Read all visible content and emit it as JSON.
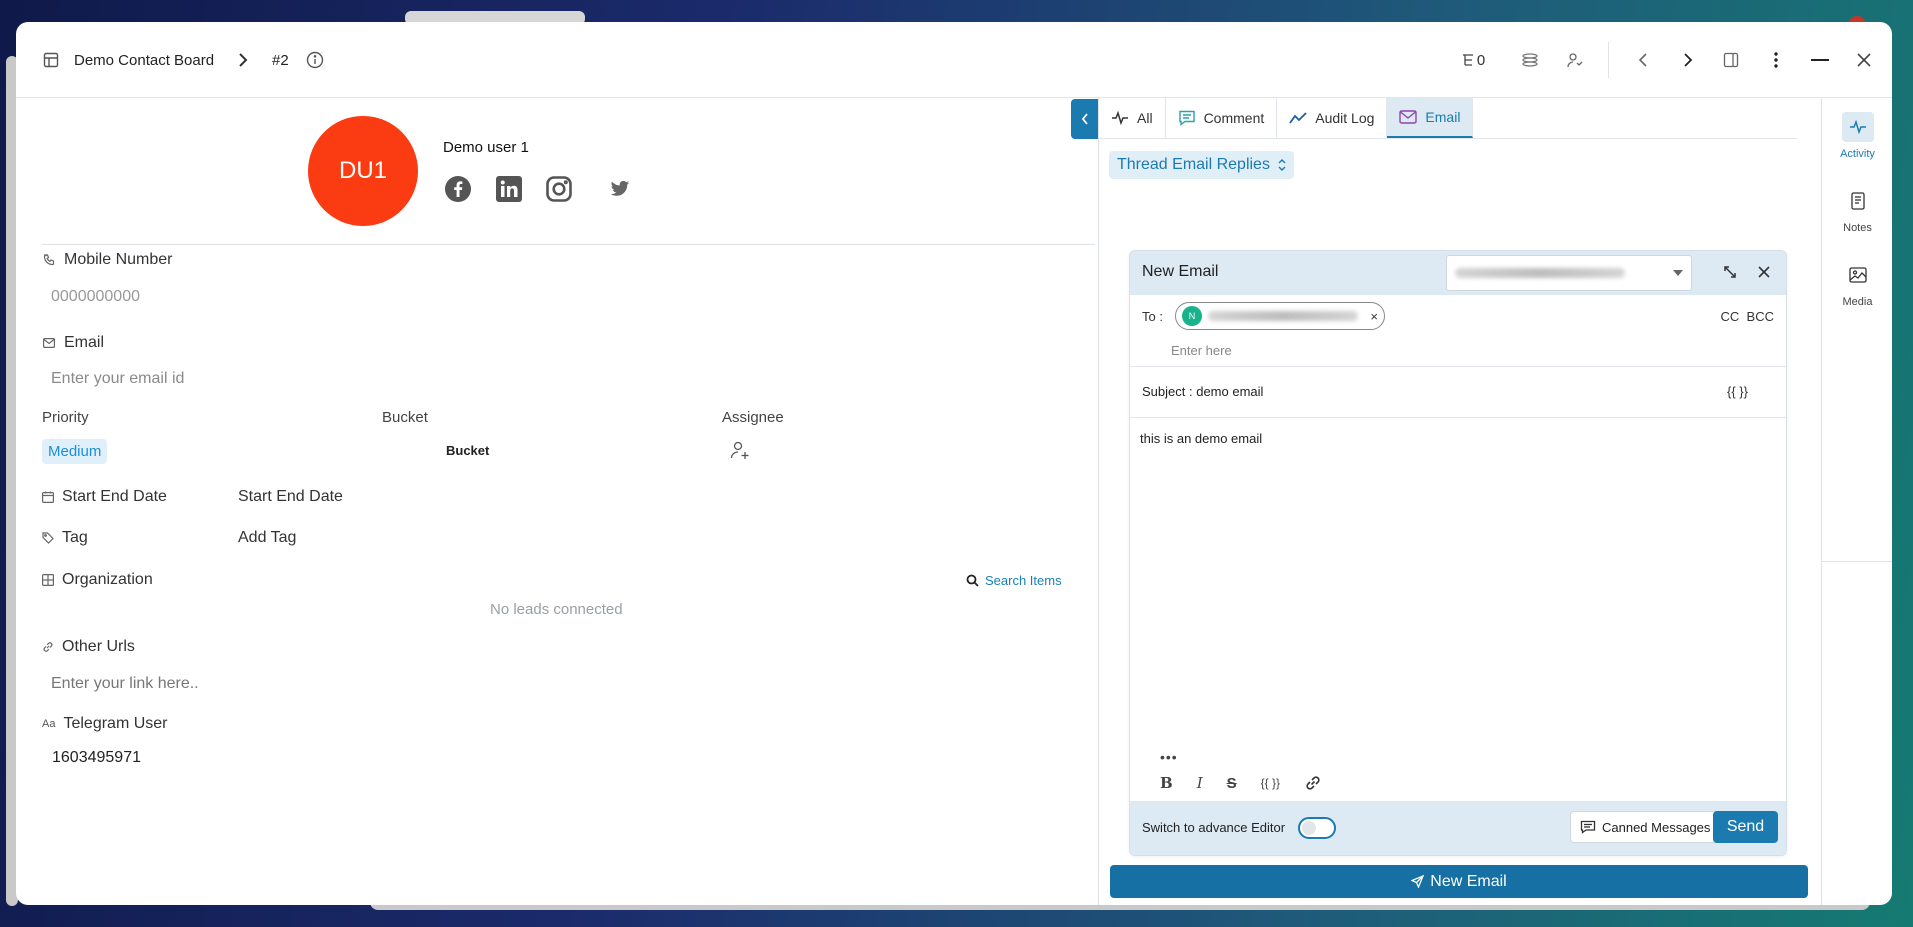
{
  "header": {
    "board_title": "Demo Contact Board",
    "record_id": "#2",
    "count": "0"
  },
  "profile": {
    "initials": "DU1",
    "name": "Demo user 1",
    "avatar_color": "#fb3b12"
  },
  "fields": {
    "mobile_label": "Mobile Number",
    "mobile_placeholder": "0000000000",
    "email_label": "Email",
    "email_placeholder": "Enter your email id",
    "priority_label": "Priority",
    "priority_value": "Medium",
    "bucket_label": "Bucket",
    "bucket_value": "Bucket",
    "assignee_label": "Assignee",
    "start_end_label": "Start End Date",
    "start_end_value": "Start End Date",
    "tag_label": "Tag",
    "tag_value": "Add Tag",
    "organization_label": "Organization",
    "search_items": "Search Items",
    "no_leads": "No leads connected",
    "other_urls_label": "Other Urls",
    "other_urls_placeholder": "Enter your link here..",
    "telegram_label": "Telegram User",
    "telegram_value": "1603495971"
  },
  "tabs": [
    {
      "label": "All",
      "icon": "activity-icon"
    },
    {
      "label": "Comment",
      "icon": "comment-icon"
    },
    {
      "label": "Audit Log",
      "icon": "audit-log-icon"
    },
    {
      "label": "Email",
      "icon": "mail-icon",
      "active": true
    }
  ],
  "thread_replies": "Thread Email Replies",
  "email": {
    "title": "New Email",
    "to_label": "To :",
    "to_chip_initial": "N",
    "cc": "CC",
    "bcc": "BCC",
    "to_placeholder": "Enter here",
    "subject_label": "Subject :",
    "subject_value": "demo email",
    "subject_variable": "{{ }}",
    "body": "this is an demo email",
    "ellipsis": "•••",
    "variable_btn": "{{ }}",
    "advance_editor_label": "Switch to advance Editor",
    "canned_label": "Canned Messages",
    "send_label": "Send"
  },
  "new_email_button": "New Email",
  "rail": [
    {
      "label": "Activity",
      "active": true
    },
    {
      "label": "Notes"
    },
    {
      "label": "Media"
    }
  ],
  "colors": {
    "accent": "#1b7bb0",
    "avatar": "#fb3b12",
    "priority_badge_bg": "#e0f0fb"
  }
}
